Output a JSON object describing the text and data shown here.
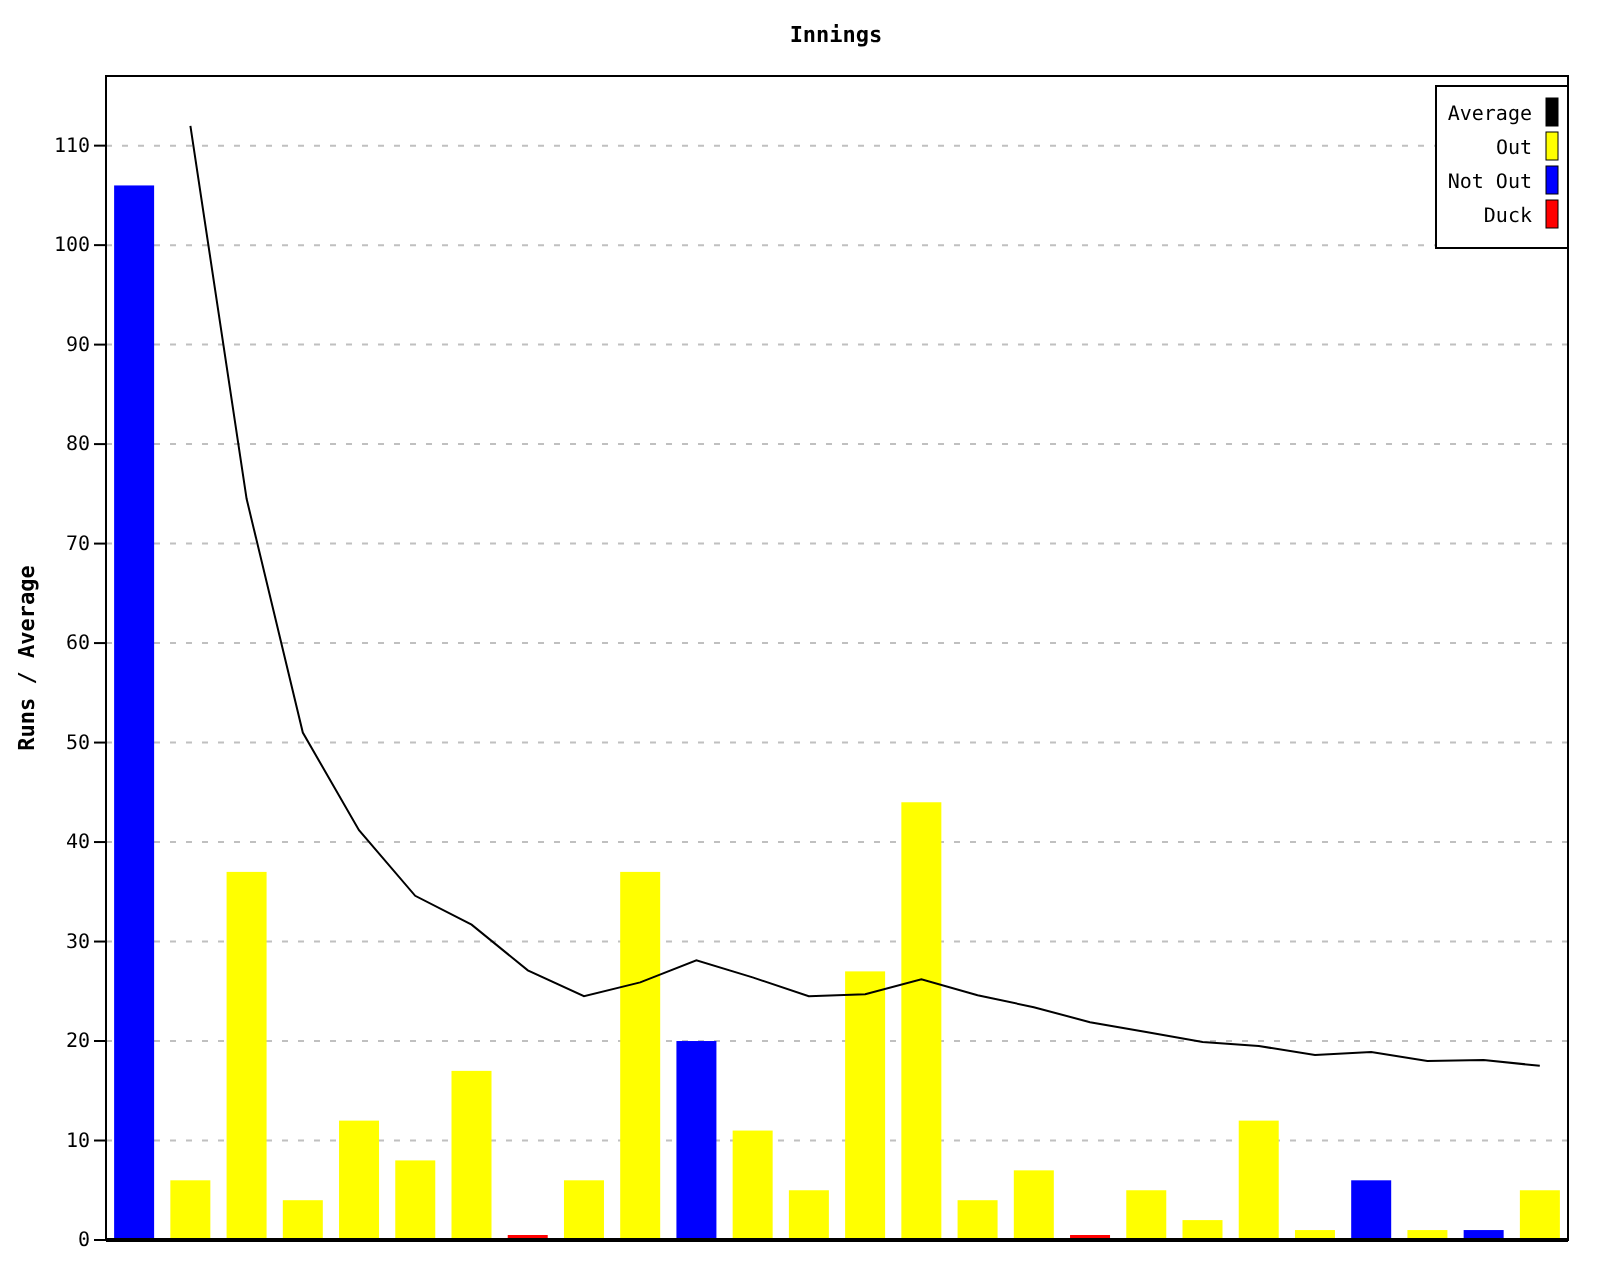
{
  "chart_data": {
    "type": "bar",
    "title": "Innings",
    "ylabel": "Runs / Average",
    "ylim": [
      0,
      117
    ],
    "yticks": [
      0,
      10,
      20,
      30,
      40,
      50,
      60,
      70,
      80,
      90,
      100,
      110
    ],
    "grid": true,
    "legend": "upper right",
    "series": [
      {
        "name": "Average",
        "type": "line",
        "color": "#000000",
        "values": [
          null,
          112,
          74.5,
          51,
          41.2,
          34.6,
          31.7,
          27.1,
          24.5,
          25.9,
          28.1,
          26.4,
          24.5,
          24.7,
          26.2,
          24.6,
          23.4,
          21.9,
          20.9,
          19.9,
          19.5,
          18.6,
          18.9,
          18,
          18.1,
          17.5
        ]
      },
      {
        "name": "Out",
        "color": "#ffff00",
        "values": [
          null,
          6,
          37,
          4,
          12,
          8,
          17,
          null,
          6,
          37,
          null,
          11,
          5,
          27,
          44,
          4,
          7,
          null,
          5,
          2,
          12,
          1,
          null,
          1,
          null,
          5
        ]
      },
      {
        "name": "Not Out",
        "color": "#0000ff",
        "values": [
          106,
          null,
          null,
          null,
          null,
          null,
          null,
          null,
          null,
          null,
          20,
          null,
          null,
          null,
          null,
          null,
          null,
          null,
          null,
          null,
          null,
          null,
          6,
          null,
          1,
          null
        ]
      },
      {
        "name": "Duck",
        "color": "#ff0000",
        "values": [
          null,
          null,
          null,
          null,
          null,
          null,
          null,
          0,
          null,
          null,
          null,
          null,
          null,
          null,
          null,
          null,
          null,
          0,
          null,
          null,
          null,
          null,
          null,
          null,
          null,
          null
        ]
      }
    ]
  }
}
